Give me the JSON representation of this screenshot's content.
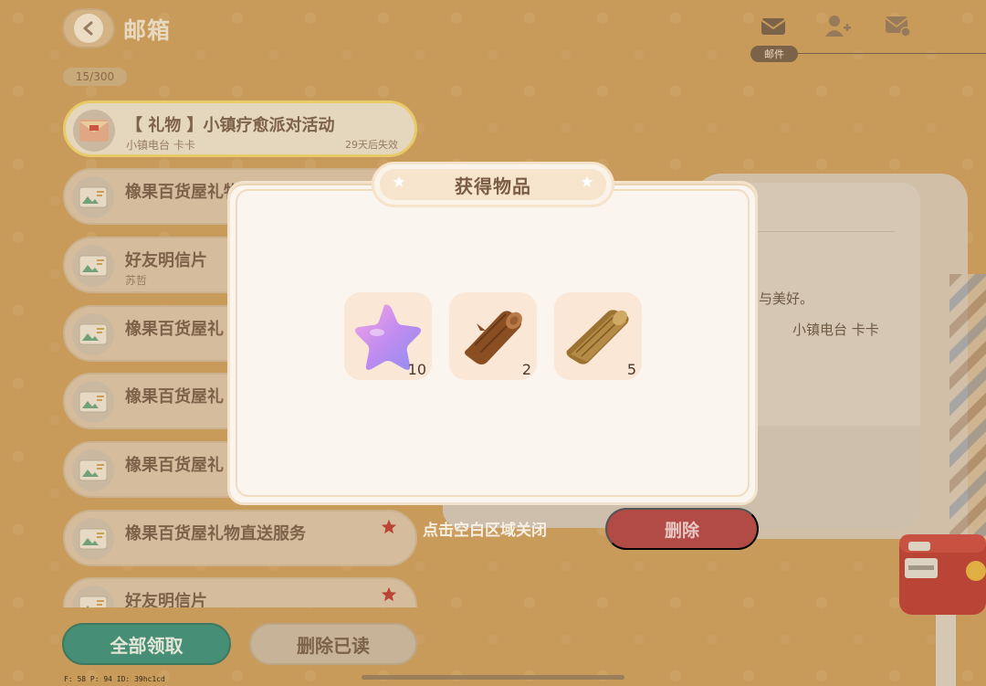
{
  "header": {
    "title": "邮箱",
    "mail_count": "15/300",
    "active_tab_label": "邮件"
  },
  "mails": [
    {
      "title": "【 礼物 】小镇疗愈派对活动",
      "sender": "小镇电台 卡卡",
      "expires": "29天后失效",
      "starred": false,
      "active": true
    },
    {
      "title": "橡果百货屋礼物直送服务",
      "sender": "",
      "expires": "",
      "starred": false,
      "active": false
    },
    {
      "title": "好友明信片",
      "sender": "苏哲",
      "expires": "",
      "starred": false,
      "active": false
    },
    {
      "title": "橡果百货屋礼",
      "sender": "",
      "expires": "",
      "starred": false,
      "active": false
    },
    {
      "title": "橡果百货屋礼",
      "sender": "",
      "expires": "",
      "starred": false,
      "active": false
    },
    {
      "title": "橡果百货屋礼",
      "sender": "",
      "expires": "",
      "starred": false,
      "active": false
    },
    {
      "title": "橡果百货屋礼物直送服务",
      "sender": "",
      "expires": "",
      "starred": true,
      "active": false
    },
    {
      "title": "好友明信片",
      "sender": "",
      "expires": "",
      "starred": true,
      "active": false
    }
  ],
  "buttons": {
    "claim_all": "全部领取",
    "delete_read": "删除已读",
    "delete": "删除"
  },
  "detail": {
    "body_fragment": "与美好。",
    "signature": "小镇电台 卡卡"
  },
  "modal": {
    "title": "获得物品",
    "close_hint": "点击空白区域关闭",
    "rewards": [
      {
        "icon": "purple-star-icon",
        "count": "10"
      },
      {
        "icon": "wood-log-icon",
        "count": "2"
      },
      {
        "icon": "timber-plank-icon",
        "count": "5"
      }
    ]
  },
  "debug": "F: 58    P: 94    ID: 39hc1cd",
  "colors": {
    "background": "#c99a58",
    "claim_button": "#2a8a7a",
    "delete_button": "#b24b45",
    "modal_bg": "#faf5ef",
    "active_border": "#f0d46a"
  }
}
